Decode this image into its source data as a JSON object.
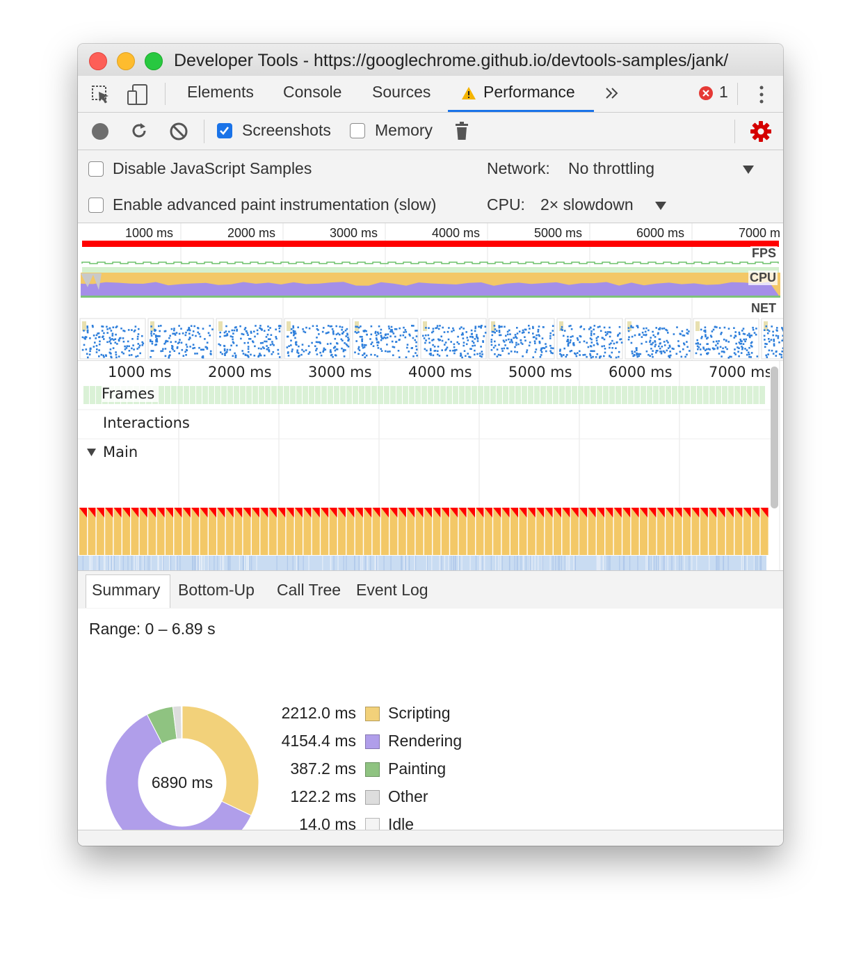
{
  "window": {
    "title": "Developer Tools - https://googlechrome.github.io/devtools-samples/jank/"
  },
  "tabs": [
    {
      "label": "Elements"
    },
    {
      "label": "Console"
    },
    {
      "label": "Sources"
    },
    {
      "label": "Performance",
      "active": true,
      "warning": true
    }
  ],
  "error_count": "1",
  "toolbar": {
    "screenshots_label": "Screenshots",
    "screenshots_checked": true,
    "memory_label": "Memory",
    "memory_checked": false
  },
  "settings": {
    "disable_js_samples": "Disable JavaScript Samples",
    "advanced_paint": "Enable advanced paint instrumentation (slow)",
    "network_label": "Network:",
    "network_value": "No throttling",
    "cpu_label": "CPU:",
    "cpu_value": "2× slowdown"
  },
  "overview": {
    "ticks": [
      "1000 ms",
      "2000 ms",
      "3000 ms",
      "4000 ms",
      "5000 ms",
      "6000 ms",
      "7000 m"
    ],
    "fps_label": "FPS",
    "cpu_label": "CPU",
    "net_label": "NET"
  },
  "timeline": {
    "ticks": [
      "1000 ms",
      "2000 ms",
      "3000 ms",
      "4000 ms",
      "5000 ms",
      "6000 ms",
      "7000 ms"
    ],
    "frames_label": "Frames",
    "interactions_label": "Interactions",
    "main_label": "Main"
  },
  "bottom_tabs": [
    {
      "label": "Summary",
      "active": true
    },
    {
      "label": "Bottom-Up"
    },
    {
      "label": "Call Tree"
    },
    {
      "label": "Event Log"
    }
  ],
  "summary": {
    "range": "Range: 0 – 6.89 s",
    "total": "6890 ms",
    "legend": [
      {
        "value": "2212.0 ms",
        "name": "Scripting",
        "ms": 2212.0,
        "color": "#f2d17a"
      },
      {
        "value": "4154.4 ms",
        "name": "Rendering",
        "ms": 4154.4,
        "color": "#b09eea"
      },
      {
        "value": "387.2 ms",
        "name": "Painting",
        "ms": 387.2,
        "color": "#8fc381"
      },
      {
        "value": "122.2 ms",
        "name": "Other",
        "ms": 122.2,
        "color": "#dddddd"
      },
      {
        "value": "14.0 ms",
        "name": "Idle",
        "ms": 14.0,
        "color": "#f4f4f4"
      }
    ]
  }
}
